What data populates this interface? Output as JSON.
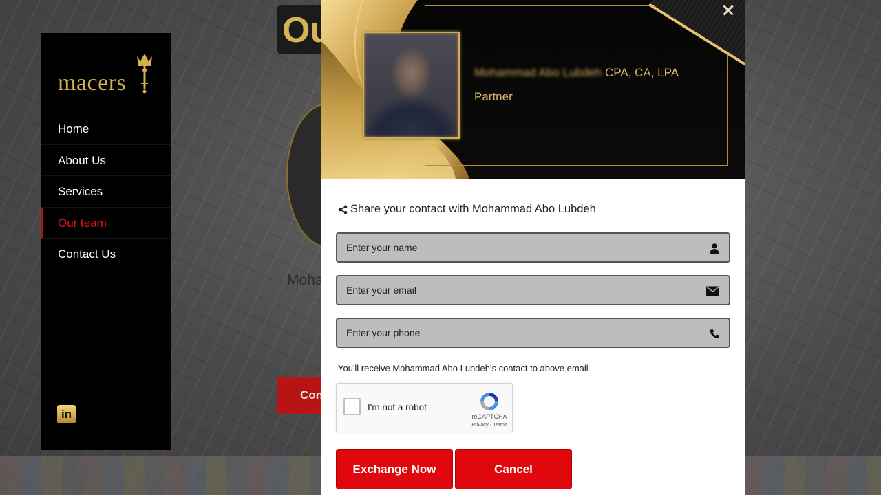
{
  "background": {
    "heading_fragment": "Our",
    "name_fragment": "Moha",
    "button_fragment": "Cont"
  },
  "sidebar": {
    "logo_text": "macers",
    "nav": [
      {
        "label": "Home"
      },
      {
        "label": "About Us"
      },
      {
        "label": "Services"
      },
      {
        "label": "Our team",
        "active": true
      },
      {
        "label": "Contact Us"
      }
    ],
    "social": {
      "linkedin_label": "in"
    }
  },
  "modal": {
    "profile": {
      "name": "Mohammad Abo Lubdeh",
      "credentials": "CPA, CA, LPA",
      "role": "Partner"
    },
    "close_icon": "×",
    "share_title": "Share your contact with Mohammad Abo Lubdeh",
    "fields": {
      "name": {
        "placeholder": "Enter your name",
        "value": "",
        "icon": "user-icon"
      },
      "email": {
        "placeholder": "Enter your email",
        "value": "",
        "icon": "envelope-icon"
      },
      "phone": {
        "placeholder": "Enter your phone",
        "value": "",
        "icon": "phone-icon"
      }
    },
    "notice": "You'll receive Mohammad Abo Lubdeh's contact to above email",
    "captcha": {
      "label": "I'm not a robot",
      "brand": "reCAPTCHA",
      "links": "Privacy - Terms"
    },
    "buttons": {
      "exchange": "Exchange Now",
      "cancel": "Cancel"
    }
  },
  "colors": {
    "accent_red": "#e0080d",
    "gold": "#d9b868",
    "sidebar_bg": "#000000",
    "active_nav": "#e0141a"
  }
}
